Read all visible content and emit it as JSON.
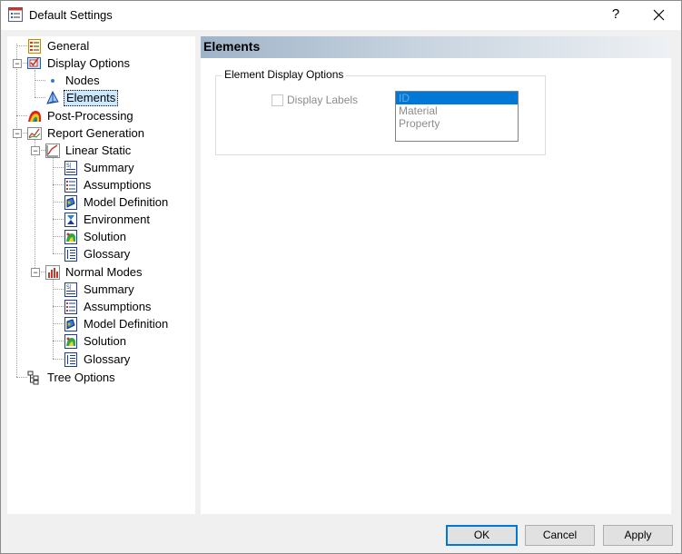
{
  "window": {
    "title": "Default Settings",
    "help_label": "?"
  },
  "tree": {
    "items": [
      {
        "label": "General",
        "icon": "checklist-icon"
      },
      {
        "label": "Display Options",
        "icon": "display-checkbox-icon"
      },
      {
        "label": "Nodes",
        "icon": "node-dot-icon"
      },
      {
        "label": "Elements",
        "icon": "element-tetra-icon",
        "selected": true
      },
      {
        "label": "Post-Processing",
        "icon": "contour-icon"
      },
      {
        "label": "Report Generation",
        "icon": "report-chart-icon"
      },
      {
        "label": "Linear Static",
        "icon": "line-chart-icon"
      },
      {
        "label": "Summary",
        "icon": "summary-doc-icon"
      },
      {
        "label": "Assumptions",
        "icon": "assumptions-list-icon"
      },
      {
        "label": "Model Definition",
        "icon": "model-definition-icon"
      },
      {
        "label": "Environment",
        "icon": "environment-icon"
      },
      {
        "label": "Solution",
        "icon": "solution-icon"
      },
      {
        "label": "Glossary",
        "icon": "glossary-icon"
      },
      {
        "label": "Normal Modes",
        "icon": "bar-chart-icon"
      },
      {
        "label": "Summary",
        "icon": "summary-doc-icon"
      },
      {
        "label": "Assumptions",
        "icon": "assumptions-list-icon"
      },
      {
        "label": "Model Definition",
        "icon": "model-definition-icon"
      },
      {
        "label": "Solution",
        "icon": "solution-icon"
      },
      {
        "label": "Glossary",
        "icon": "glossary-icon"
      },
      {
        "label": "Tree Options",
        "icon": "tree-structure-icon"
      }
    ]
  },
  "panel": {
    "title": "Elements",
    "group_title": "Element Display Options",
    "display_labels": {
      "label": "Display Labels",
      "checked": false,
      "enabled": false
    },
    "label_options": [
      "ID",
      "Material",
      "Property"
    ],
    "selected_option": "ID"
  },
  "buttons": {
    "ok": "OK",
    "cancel": "Cancel",
    "apply": "Apply"
  },
  "colors": {
    "selection": "#0078d7",
    "header_gradient_start": "#9fb3c8"
  }
}
